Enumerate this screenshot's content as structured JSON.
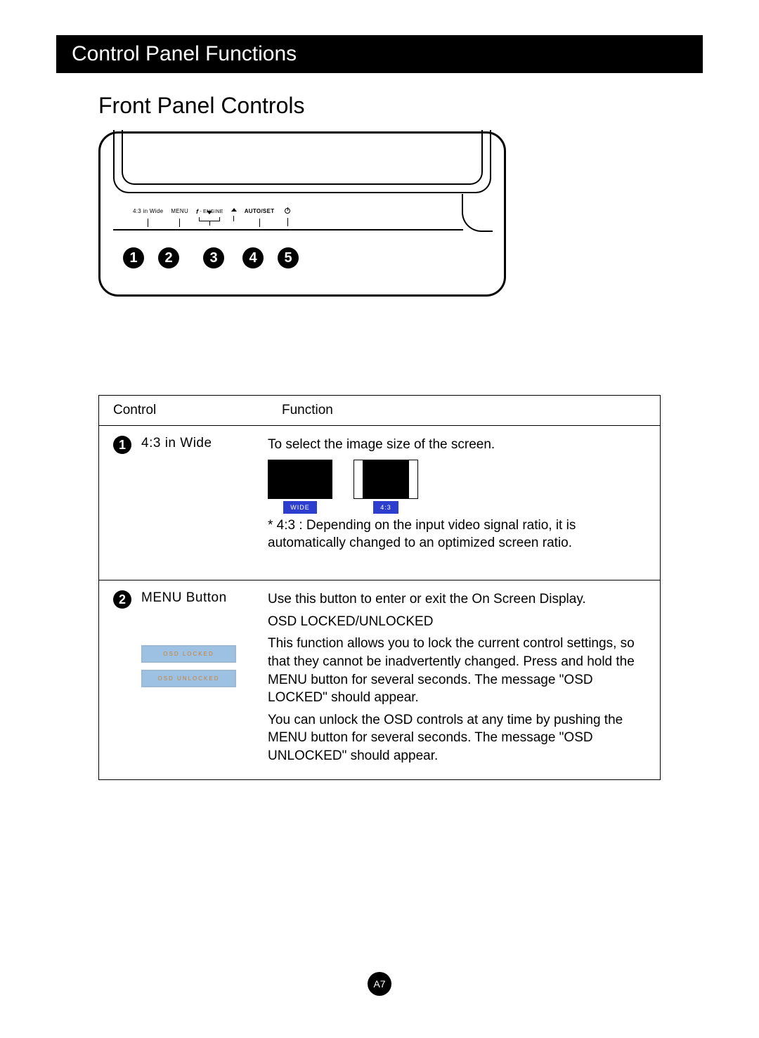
{
  "header": {
    "title": "Control Panel Functions"
  },
  "subtitle": "Front Panel Controls",
  "diagram": {
    "buttons": {
      "b1": "4:3 in Wide",
      "b2": "MENU",
      "b3_engine": "ENGINE",
      "b4": "AUTO/SET"
    }
  },
  "callouts": [
    "1",
    "2",
    "3",
    "4",
    "5"
  ],
  "table": {
    "head": {
      "left": "Control",
      "right": "Function"
    },
    "rows": [
      {
        "num": "1",
        "control": "4:3 in Wide",
        "fn_line1": "To select the image size of the screen.",
        "aspect": {
          "wide": "WIDE",
          "n43": "4:3"
        },
        "note": "* 4:3 : Depending on the input video signal ratio, it is automatically changed to an optimized screen ratio."
      },
      {
        "num": "2",
        "control": "MENU Button",
        "osd_locked": "OSD LOCKED",
        "osd_unlocked": "OSD UNLOCKED",
        "fn_line1": "Use this button to enter or exit the On Screen Display.",
        "heading": "OSD LOCKED/UNLOCKED",
        "p1": "This function allows you to lock the current control settings, so that they cannot be inadvertently changed. Press and hold the MENU button for several seconds. The message \"OSD LOCKED\" should appear.",
        "p2": "You can unlock the OSD controls at any time by pushing the MENU button for several seconds. The message \"OSD UNLOCKED\" should appear."
      }
    ]
  },
  "page_number": "A7"
}
